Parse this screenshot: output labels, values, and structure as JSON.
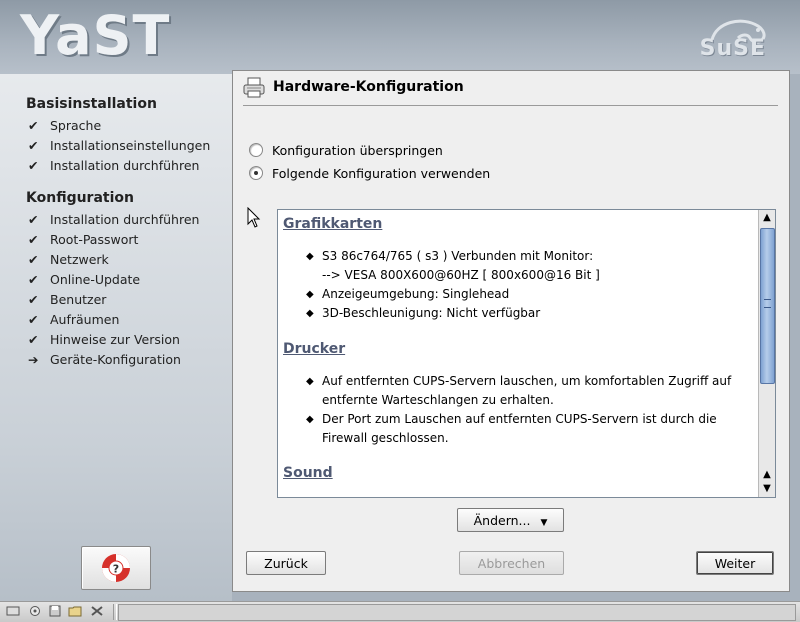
{
  "header": {
    "app_logo": "YaST",
    "vendor_logo": "SuSE"
  },
  "sidebar": {
    "sections": [
      {
        "title": "Basisinstallation",
        "steps": [
          {
            "label": "Sprache",
            "mark": "✔"
          },
          {
            "label": "Installationseinstellungen",
            "mark": "✔"
          },
          {
            "label": "Installation durchführen",
            "mark": "✔"
          }
        ]
      },
      {
        "title": "Konfiguration",
        "steps": [
          {
            "label": "Installation durchführen",
            "mark": "✔"
          },
          {
            "label": "Root-Passwort",
            "mark": "✔"
          },
          {
            "label": "Netzwerk",
            "mark": "✔"
          },
          {
            "label": "Online-Update",
            "mark": "✔"
          },
          {
            "label": "Benutzer",
            "mark": "✔"
          },
          {
            "label": "Aufräumen",
            "mark": "✔"
          },
          {
            "label": "Hinweise zur Version",
            "mark": "✔"
          },
          {
            "label": "Geräte-Konfiguration",
            "mark": "➔"
          }
        ]
      }
    ],
    "help_icon": "lifebuoy-help-icon"
  },
  "main": {
    "title": "Hardware-Konfiguration",
    "title_icon": "printer-icon",
    "radio_skip": "Konfiguration überspringen",
    "radio_use": "Folgende Konfiguration verwenden",
    "selected_option": "Folgende Konfiguration verwenden",
    "details": {
      "sections": [
        {
          "heading": "Grafikkarten",
          "items": [
            "S3 86c764/765 ( s3 ) Verbunden mit Monitor:\n--> VESA 800X600@60HZ [ 800x600@16 Bit ]",
            "Anzeigeumgebung: Singlehead",
            "3D-Beschleunigung: Nicht verfügbar"
          ]
        },
        {
          "heading": "Drucker",
          "items": [
            "Auf entfernten CUPS-Servern lauschen, um komfortablen Zugriff auf entfernte Warteschlangen zu erhalten.",
            "Der Port zum Lauschen auf entfernten CUPS-Servern ist durch die Firewall geschlossen."
          ]
        },
        {
          "heading": "Sound",
          "items": []
        }
      ]
    },
    "change_button": "Ändern...",
    "back_button": "Zurück",
    "abort_button": "Abbrechen",
    "next_button": "Weiter"
  },
  "colors": {
    "accent": "#4f5973",
    "scroll_thumb": "#7fa2d2"
  }
}
